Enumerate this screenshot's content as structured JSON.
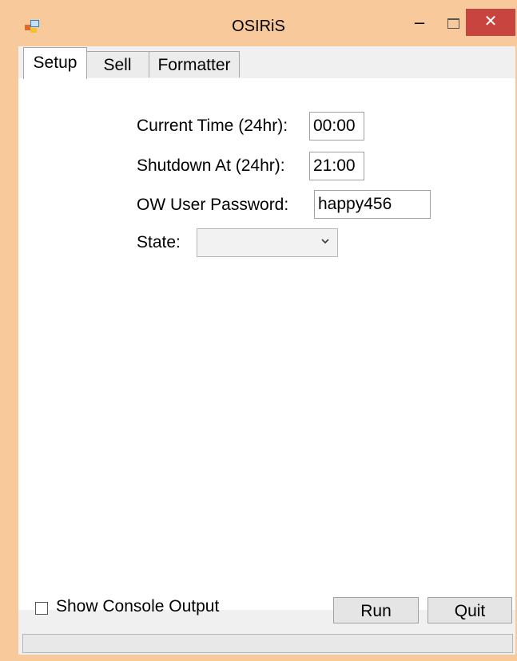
{
  "window": {
    "title": "OSIRiS",
    "minimize_glyph": "–",
    "close_glyph": "✕",
    "accent_color": "#f8c99a",
    "close_color": "#c7453e"
  },
  "tabs": [
    {
      "label": "Setup",
      "active": true
    },
    {
      "label": "Sell",
      "active": false
    },
    {
      "label": "Formatter",
      "active": false
    }
  ],
  "setup": {
    "current_time_label": "Current Time (24hr):",
    "current_time_value": "00:00",
    "shutdown_label": "Shutdown At (24hr):",
    "shutdown_value": "21:00",
    "password_label": "OW User Password:",
    "password_value": "happy456",
    "state_label": "State:",
    "state_value": ""
  },
  "footer": {
    "show_console_label": "Show Console Output",
    "show_console_checked": false,
    "run_label": "Run",
    "quit_label": "Quit"
  }
}
